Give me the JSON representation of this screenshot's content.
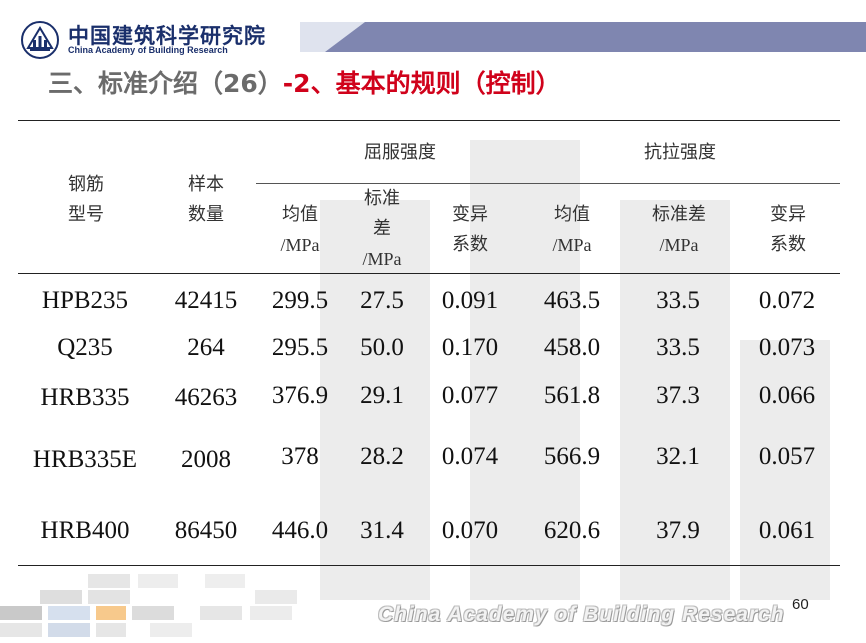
{
  "header": {
    "org_name_cn": "中国建筑科学研究院",
    "org_name_en": "China Academy of Building Research",
    "title_part1": "三、标准介绍（26）",
    "title_part2": "-2、基本的规则（控制）",
    "colors": {
      "title_gray": "#6b6b6b",
      "title_red": "#d0021b",
      "brand_blue": "#1a2f6b"
    }
  },
  "table": {
    "col_steel_type": [
      "钢筋",
      "型号"
    ],
    "col_sample_count": [
      "样本",
      "数量"
    ],
    "group_yield": "屈服强度",
    "group_tensile": "抗拉强度",
    "sub_mean": [
      "均值",
      "/MPa"
    ],
    "sub_std_yield": [
      "标准",
      "差",
      "/MPa"
    ],
    "sub_cv": [
      "变异",
      "系数"
    ],
    "sub_std_tensile": [
      "标准差",
      "/MPa"
    ],
    "rows": [
      {
        "type": "HPB235",
        "count": "42415",
        "y_mean": "299.5",
        "y_std": "27.5",
        "y_cv": "0.091",
        "t_mean": "463.5",
        "t_std": "33.5",
        "t_cv": "0.072"
      },
      {
        "type": "Q235",
        "count": "264",
        "y_mean": "295.5",
        "y_std": "50.0",
        "y_cv": "0.170",
        "t_mean": "458.0",
        "t_std": "33.5",
        "t_cv": "0.073"
      },
      {
        "type": "HRB335",
        "count": "46263",
        "y_mean": "376.9",
        "y_std": "29.1",
        "y_cv": "0.077",
        "t_mean": "561.8",
        "t_std": "37.3",
        "t_cv": "0.066"
      },
      {
        "type": "HRB335E",
        "count": "2008",
        "y_mean": "378",
        "y_std": "28.2",
        "y_cv": "0.074",
        "t_mean": "566.9",
        "t_std": "32.1",
        "t_cv": "0.057"
      },
      {
        "type": "HRB400",
        "count": "86450",
        "y_mean": "446.0",
        "y_std": "31.4",
        "y_cv": "0.070",
        "t_mean": "620.6",
        "t_std": "37.9",
        "t_cv": "0.061"
      }
    ]
  },
  "footer": {
    "org_name_en": "China Academy of Building Research",
    "page_number": "60"
  }
}
